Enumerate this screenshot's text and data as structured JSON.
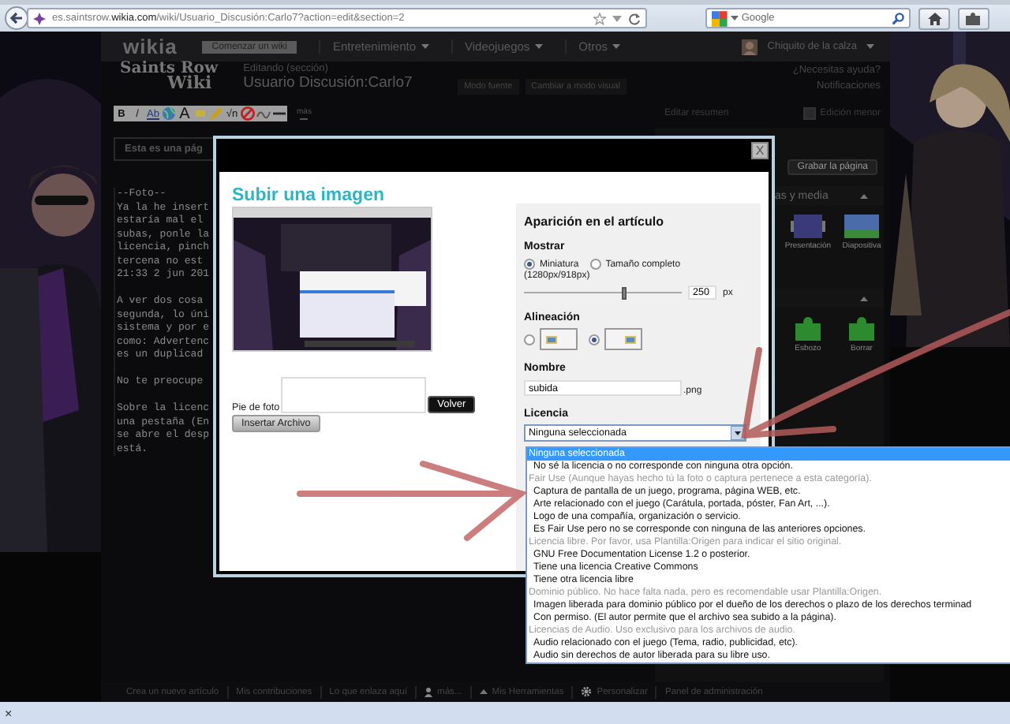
{
  "browser": {
    "url": "es.saintsrow.**wikia.com**/wiki/Usuario_Discusión:Carlo7?action=edit&section=2",
    "search_placeholder": "Google"
  },
  "wikia_header": {
    "logo": "wikia",
    "start_button": "Comenzar un wiki",
    "nav": [
      "Entretenimiento",
      "Videojuegos",
      "Otros"
    ],
    "user": "Chiquito de la calza"
  },
  "edit_header": {
    "logo_lines": [
      "Saints Row",
      "Wiki"
    ],
    "mode": "Editando (sección)",
    "page_title": "Usuario Discusión:Carlo7",
    "buttons": [
      "Modo fuente",
      "Cambiar a modo visual"
    ],
    "help": "¿Necesitas ayuda?",
    "notifications": "Notificaciones"
  },
  "editor": {
    "toolbar": [
      {
        "kind": "bold",
        "label": "B"
      },
      {
        "kind": "italic",
        "label": "/"
      },
      {
        "kind": "link",
        "label": "Ab"
      },
      {
        "kind": "globe"
      },
      {
        "kind": "large",
        "label": "A"
      },
      {
        "kind": "tag"
      },
      {
        "kind": "pencil"
      },
      {
        "kind": "formula",
        "label": "√n"
      },
      {
        "kind": "forbid"
      },
      {
        "kind": "scribble"
      },
      {
        "kind": "rule"
      }
    ],
    "more": "más",
    "notice": "Esta es una pág",
    "paragraphs": [
      [
        "--Foto--",
        "Ya la he insert",
        "estaría mal el",
        "subas, ponle la",
        "licencia, pinch",
        "tercena no est",
        "21:33 2 jun 201"
      ],
      [
        "A ver dos cosa",
        "segunda, lo úni",
        "sistema y por e",
        "como: Advertenc",
        "es un duplicad"
      ],
      [
        "No te preocupe"
      ],
      [
        "Sobre la licenc",
        "una pestaña (En",
        "se abre el desp",
        "está."
      ]
    ]
  },
  "rail": {
    "summary_label": "Editar resumen",
    "minor_edit": {
      "label": "Edición menor",
      "checked": false
    },
    "save": "Grabar la página",
    "section": "as y media",
    "media_tiles": [
      "Presentación",
      "Diapositiva"
    ],
    "template_tiles": [
      "Esbozo",
      "Borrar"
    ]
  },
  "footer": [
    {
      "kind": "plain",
      "label": "Crea un nuevo artículo"
    },
    {
      "kind": "plain",
      "label": "Mis contribuciones"
    },
    {
      "kind": "plain",
      "label": "Lo que enlaza aquí"
    },
    {
      "kind": "more",
      "label": "más..."
    },
    {
      "kind": "tools",
      "label": "Mis Herramientas"
    },
    {
      "kind": "settings",
      "label": "Personalizar"
    },
    {
      "kind": "plain",
      "label": "Panel de administración"
    }
  ],
  "modal": {
    "close": "X",
    "title": "Subir una imagen",
    "caption_label": "Pie de foto",
    "back": "Volver",
    "insert": "Insertar Archivo",
    "panel": {
      "heading": "Aparición en el artículo",
      "display_label": "Mostrar",
      "sizes": [
        {
          "label": "Miniatura",
          "selected": true
        },
        {
          "label": "Tamaño completo",
          "selected": false
        }
      ],
      "dimensions": "(1280px/918px)",
      "width": {
        "value": "250",
        "unit": "px",
        "level": 0.63
      },
      "alignment_label": "Alineación",
      "alignments": [
        {
          "kind": "left",
          "selected": false
        },
        {
          "kind": "right",
          "selected": true
        }
      ],
      "name_label": "Nombre",
      "name_value": "subida",
      "extension": ".png",
      "license_label": "Licencia",
      "license_value": "Ninguna seleccionada"
    }
  },
  "license_options": [
    {
      "kind": "option",
      "label": "Ninguna seleccionada",
      "selected": true
    },
    {
      "kind": "option",
      "label": "No sé la licencia o no corresponde con ninguna otra opción.",
      "selected": false
    },
    {
      "kind": "group",
      "label": "Fair Use (Aunque hayas hecho tú la foto o captura pertenece a esta categoría).",
      "selected": false
    },
    {
      "kind": "option",
      "label": "Captura de pantalla de un juego, programa, página WEB, etc.",
      "selected": false
    },
    {
      "kind": "option",
      "label": "Arte relacionado con el juego (Carátula, portada, póster, Fan Art, ...).",
      "selected": false
    },
    {
      "kind": "option",
      "label": "Logo de una compañía, organización o servicio.",
      "selected": false
    },
    {
      "kind": "option",
      "label": "Es Fair Use pero no se corresponde con ninguna de las anteriores opciones.",
      "selected": false
    },
    {
      "kind": "group",
      "label": "Licencia libre. Por favor, usa Plantilla:Origen para indicar el sitio original.",
      "selected": false
    },
    {
      "kind": "option",
      "label": "GNU Free Documentation License 1.2 o posterior.",
      "selected": false
    },
    {
      "kind": "option",
      "label": "Tiene una licencia Creative Commons",
      "selected": false
    },
    {
      "kind": "option",
      "label": "Tiene otra licencia libre",
      "selected": false
    },
    {
      "kind": "group",
      "label": "Dominio público. No hace falta nada, pero es recomendable usar Plantilla:Origen.",
      "selected": false
    },
    {
      "kind": "option",
      "label": "Imagen liberada para dominio público por el dueño de los derechos o plazo de los derechos terminad",
      "selected": false
    },
    {
      "kind": "option",
      "label": "Con permiso. (El autor permite que el archivo sea subido a la página).",
      "selected": false
    },
    {
      "kind": "group",
      "label": "Licencias de Audio. Uso exclusivo para los archivos de audio.",
      "selected": false
    },
    {
      "kind": "option",
      "label": "Audio relacionado con el juego (Tema, radio, publicidad, etc).",
      "selected": false
    },
    {
      "kind": "option",
      "label": "Audio sin derechos de autor liberada para su libre uso.",
      "selected": false
    }
  ],
  "status_bar": {
    "close": "×"
  }
}
